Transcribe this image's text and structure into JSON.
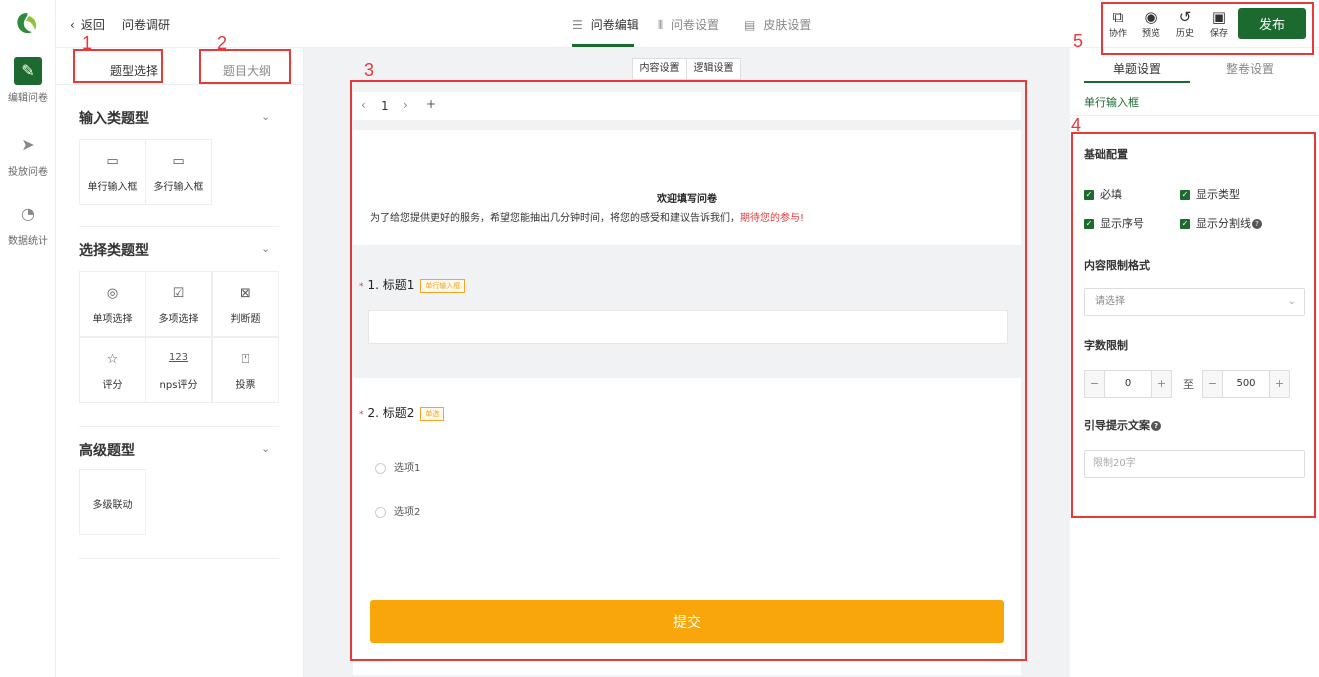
{
  "nav": {
    "items": [
      {
        "icon": "edit-icon",
        "glyph": "✎",
        "label": "编辑问卷",
        "active": true
      },
      {
        "icon": "send-icon",
        "glyph": "➤",
        "label": "投放问卷",
        "active": false
      },
      {
        "icon": "chart-icon",
        "glyph": "◔",
        "label": "数据统计",
        "active": false
      }
    ]
  },
  "header": {
    "back_label": "返回",
    "title": "问卷调研",
    "tabs": [
      {
        "icon": "form-icon",
        "glyph": "☰",
        "label": "问卷编辑"
      },
      {
        "icon": "settings-icon",
        "glyph": "⫴",
        "label": "问卷设置"
      },
      {
        "icon": "skin-icon",
        "glyph": "▤",
        "label": "皮肤设置"
      }
    ],
    "tools": [
      {
        "icon": "collaborate-icon",
        "glyph": "⧉",
        "label": "协作"
      },
      {
        "icon": "preview-icon",
        "glyph": "◉",
        "label": "预览"
      },
      {
        "icon": "history-icon",
        "glyph": "↺",
        "label": "历史"
      },
      {
        "icon": "save-icon",
        "glyph": "▣",
        "label": "保存"
      }
    ],
    "publish_label": "发布"
  },
  "left_panel": {
    "tabs": [
      "题型选择",
      "题目大纲"
    ],
    "groups": [
      {
        "title": "输入类题型",
        "items": [
          {
            "icon": "input-single-icon",
            "glyph": "▭",
            "label": "单行输入框"
          },
          {
            "icon": "input-multi-icon",
            "glyph": "▭",
            "label": "多行输入框"
          }
        ]
      },
      {
        "title": "选择类题型",
        "items": [
          {
            "icon": "radio-icon",
            "glyph": "◎",
            "label": "单项选择"
          },
          {
            "icon": "checkbox-icon",
            "glyph": "☑",
            "label": "多项选择"
          },
          {
            "icon": "judge-icon",
            "glyph": "⊠",
            "label": "判断题"
          },
          {
            "icon": "star-icon",
            "glyph": "☆",
            "label": "评分"
          },
          {
            "icon": "nps-icon",
            "glyph": "123",
            "label": "nps评分"
          },
          {
            "icon": "vote-icon",
            "glyph": "⍞",
            "label": "投票"
          }
        ]
      },
      {
        "title": "高级题型",
        "items": [
          {
            "icon": "cascade-icon",
            "glyph": "",
            "label": "多级联动"
          }
        ]
      }
    ]
  },
  "canvas": {
    "mode_tabs": [
      "内容设置",
      "逻辑设置"
    ],
    "page_number": "1",
    "welcome": "欢迎填写问卷",
    "description_main": "为了给您提供更好的服务，希望您能抽出几分钟时间，将您的感受和建议告诉我们，",
    "description_highlight": "期待您的参与!",
    "questions": [
      {
        "number": "1.",
        "title": "标题1",
        "type_badge": "单行输入框"
      },
      {
        "number": "2.",
        "title": "标题2",
        "type_badge": "单选",
        "options": [
          "选项1",
          "选项2"
        ]
      }
    ],
    "submit_label": "提交"
  },
  "right_panel": {
    "tabs": [
      "单题设置",
      "整卷设置"
    ],
    "subtitle": "单行输入框",
    "basic_config_title": "基础配置",
    "checkboxes": [
      "必填",
      "显示类型",
      "显示序号",
      "显示分割线"
    ],
    "format_title": "内容限制格式",
    "format_placeholder": "请选择",
    "length_title": "字数限制",
    "min_value": "0",
    "to_label": "至",
    "max_value": "500",
    "hint_title": "引导提示文案",
    "hint_placeholder": "限制20字"
  },
  "annotations": [
    "1",
    "2",
    "3",
    "4",
    "5"
  ],
  "colors": {
    "brand": "#1c6a2f",
    "submit": "#f9a60c",
    "annotation": "#e5393a",
    "highlight": "#e23b3b"
  }
}
